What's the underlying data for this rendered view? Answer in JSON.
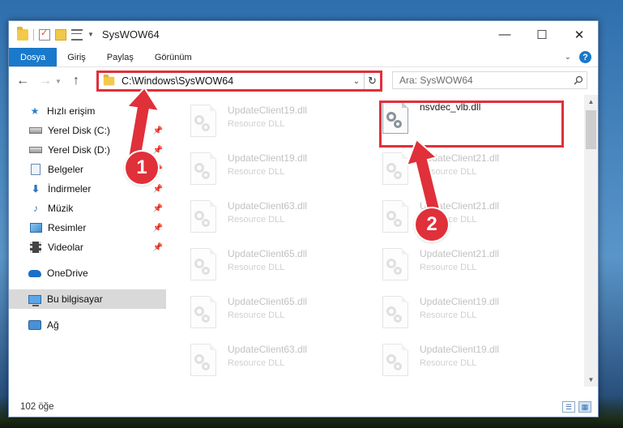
{
  "window": {
    "title": "SysWOW64",
    "controls": {
      "minimize": "—",
      "maximize": "☐",
      "close": "✕"
    }
  },
  "ribbon": {
    "tabs": [
      {
        "label": "Dosya",
        "active": true
      },
      {
        "label": "Giriş"
      },
      {
        "label": "Paylaş"
      },
      {
        "label": "Görünüm"
      }
    ],
    "help": "?"
  },
  "nav": {
    "back": "←",
    "forward": "→",
    "up": "↑",
    "address": "C:\\Windows\\SysWOW64",
    "search_placeholder": "Ara: SysWOW64",
    "refresh": "↻"
  },
  "sidebar": {
    "items": [
      {
        "label": "Hızlı erişim",
        "icon": "star-icon"
      },
      {
        "label": "Yerel Disk (C:)",
        "icon": "disk-icon",
        "pinned": true
      },
      {
        "label": "Yerel Disk (D:)",
        "icon": "disk-icon",
        "pinned": true
      },
      {
        "label": "Belgeler",
        "icon": "document-icon",
        "pinned": true
      },
      {
        "label": "İndirmeler",
        "icon": "download-icon",
        "pinned": true
      },
      {
        "label": "Müzik",
        "icon": "music-icon",
        "pinned": true
      },
      {
        "label": "Resimler",
        "icon": "pictures-icon",
        "pinned": true
      },
      {
        "label": "Videolar",
        "icon": "video-icon",
        "pinned": true
      },
      {
        "label": "OneDrive",
        "icon": "onedrive-icon"
      },
      {
        "label": "Bu bilgisayar",
        "icon": "computer-icon",
        "selected": true
      },
      {
        "label": "Ağ",
        "icon": "network-icon"
      }
    ]
  },
  "files": {
    "left_column": [
      {
        "name": "UpdateClient19.dll",
        "type": "Resource DLL"
      },
      {
        "name": "UpdateClient19.dll",
        "type": "Resource DLL"
      },
      {
        "name": "UpdateClient63.dll",
        "type": "Resource DLL"
      },
      {
        "name": "UpdateClient65.dll",
        "type": "Resource DLL"
      },
      {
        "name": "UpdateClient65.dll",
        "type": "Resource DLL"
      },
      {
        "name": "UpdateClient63.dll",
        "type": "Resource DLL"
      }
    ],
    "right_column": [
      {
        "name": "nsvdec_vlb.dll",
        "type": "",
        "highlighted": true
      },
      {
        "name": "UpdateClient21.dll",
        "type": "Resource DLL"
      },
      {
        "name": "UpdateClient21.dll",
        "type": "Resource DLL"
      },
      {
        "name": "UpdateClient21.dll",
        "type": "Resource DLL"
      },
      {
        "name": "UpdateClient19.dll",
        "type": "Resource DLL"
      },
      {
        "name": "UpdateClient19.dll",
        "type": "Resource DLL"
      }
    ]
  },
  "status": {
    "item_count": "102 öğe"
  },
  "callouts": {
    "first": "1",
    "second": "2"
  },
  "colors": {
    "accent": "#1979ca",
    "annotation": "#e0303a"
  }
}
